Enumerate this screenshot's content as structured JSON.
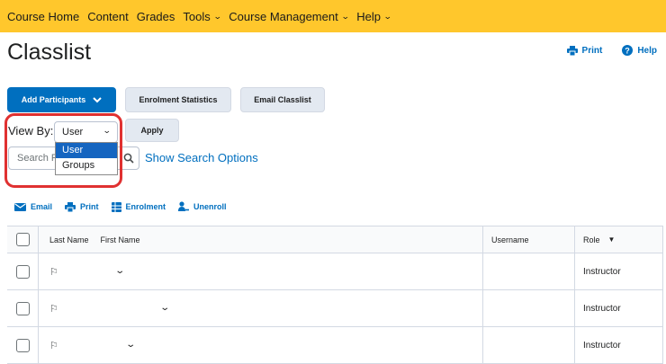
{
  "topnav": {
    "items": [
      {
        "label": "Course Home"
      },
      {
        "label": "Content"
      },
      {
        "label": "Grades"
      },
      {
        "label": "Tools"
      },
      {
        "label": "Course Management"
      },
      {
        "label": "Help"
      }
    ]
  },
  "header": {
    "title": "Classlist",
    "print_label": "Print",
    "help_label": "Help"
  },
  "buttons": {
    "add_participants": "Add Participants",
    "enrolment_statistics": "Enrolment Statistics",
    "email_classlist": "Email Classlist"
  },
  "viewby": {
    "label": "View By:",
    "selected": "User",
    "options": [
      "User",
      "Groups"
    ],
    "apply_label": "Apply"
  },
  "search": {
    "value": "Search F",
    "show_options_label": "Show Search Options"
  },
  "bulk_actions": {
    "email": "Email",
    "print": "Print",
    "enrolment": "Enrolment",
    "unenroll": "Unenroll"
  },
  "table": {
    "headers": {
      "last_name": "Last Name",
      "first_name": "First Name",
      "username": "Username",
      "role": "Role"
    },
    "rows": [
      {
        "role": "Instructor"
      },
      {
        "role": "Instructor"
      },
      {
        "role": "Instructor"
      }
    ]
  },
  "colors": {
    "navbar": "#ffc72c",
    "primary": "#006fbf",
    "highlight": "#e03131"
  }
}
